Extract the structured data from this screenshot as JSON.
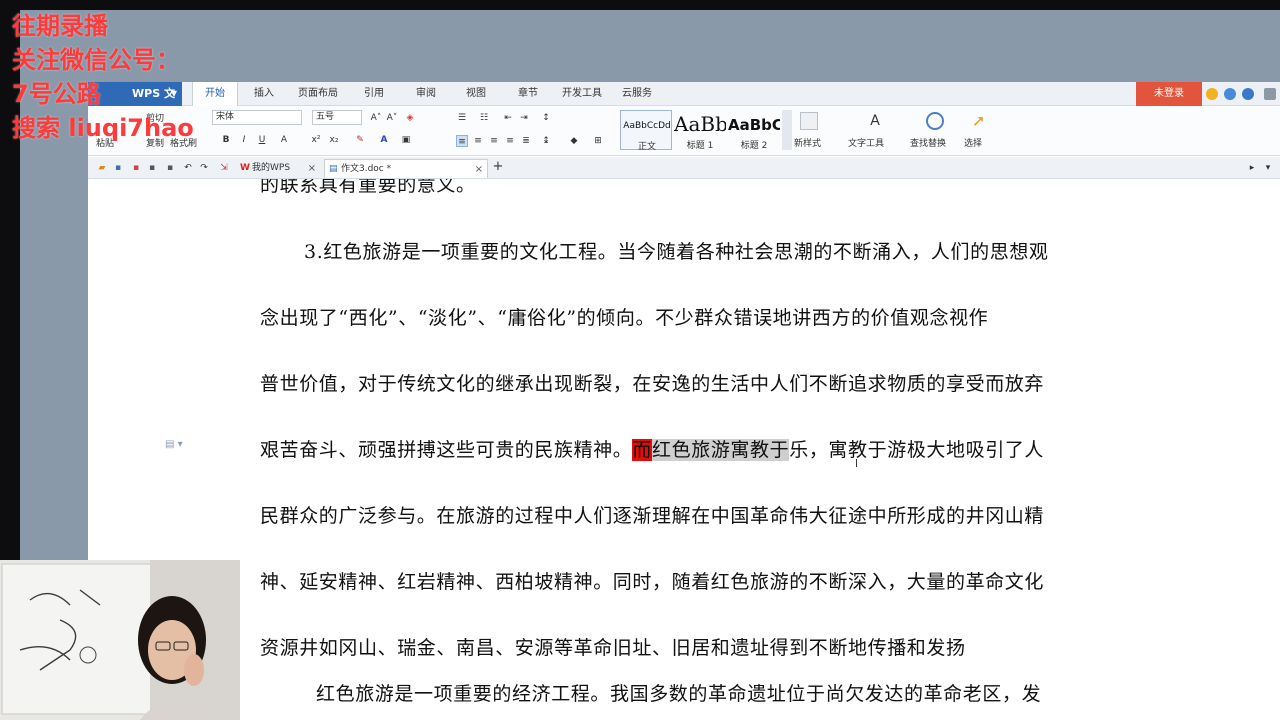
{
  "overlay": {
    "line1": "往期录播",
    "line2": "关注微信公号：",
    "line3": "7号公路",
    "line4": "搜索  liuqi7hao"
  },
  "app": {
    "name": "WPS 文字",
    "menu_tabs": [
      "开始",
      "插入",
      "页面布局",
      "引用",
      "审阅",
      "视图",
      "章节",
      "开发工具",
      "云服务"
    ],
    "login": "未登录"
  },
  "ribbon": {
    "cut": "剪切",
    "paste": "粘贴",
    "copy": "复制",
    "format_painter": "格式刷",
    "font_name": "宋体",
    "font_size": "五号",
    "styles": [
      {
        "sample": "AaBbCcDd",
        "label": "正文"
      },
      {
        "sample": "AaBb",
        "label": "标题 1"
      },
      {
        "sample": "AaBbC",
        "label": "标题 2"
      }
    ],
    "new_style": "新样式",
    "text_tools": "文字工具",
    "find_replace": "查找替换",
    "select": "选择"
  },
  "tabs": {
    "home": "我的WPS",
    "doc": "作文3.doc *"
  },
  "document": {
    "top_partial": "的联系具有重要的意义。",
    "lines": [
      "3.红色旅游是一项重要的文化工程。当今随着各种社会思潮的不断涌入，人们的思想观",
      "念出现了“西化”、“淡化”、“庸俗化”的倾向。不少群众错误地讲西方的价值观念视作",
      "普世价值，对于传统文化的继承出现断裂，在安逸的生活中人们不断追求物质的享受而放弃"
    ],
    "line4_before": "艰苦奋斗、顽强拼搏这些可贵的民族精神。",
    "line4_red": "而",
    "line4_selected": "红色旅游寓教于",
    "line4_after": "乐，寓教于游极大地吸引了人",
    "lines_after": [
      "民群众的广泛参与。在旅游的过程中人们逐渐理解在中国革命伟大征途中所形成的井冈山精",
      "神、延安精神、红岩精神、西柏坡精神。同时，随着红色旅游的不断深入，大量的革命文化",
      "资源井如冈山、瑞金、南昌、安源等革命旧址、旧居和遗址得到不断地传播和发扬",
      "红色旅游是一项重要的经济工程。我国多数的革命遗址位于尚欠发达的革命老区，发"
    ]
  }
}
